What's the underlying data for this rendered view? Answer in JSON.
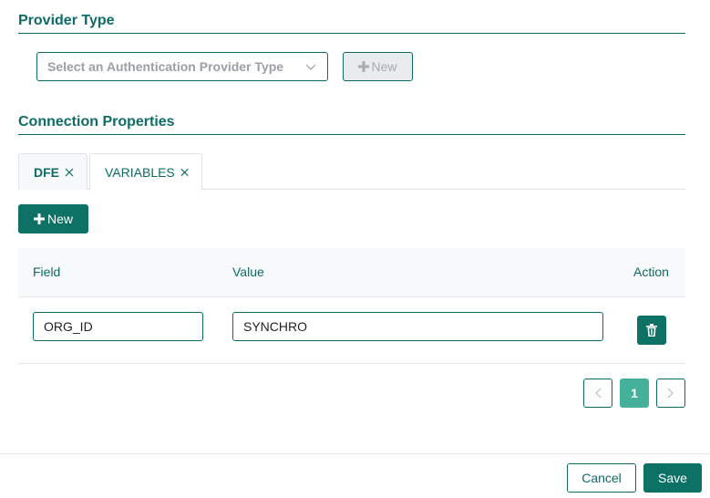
{
  "provider_type": {
    "title": "Provider Type",
    "select_placeholder": "Select an Authentication Provider Type",
    "new_label": "New"
  },
  "connection_properties": {
    "title": "Connection Properties",
    "tabs": [
      {
        "label": "DFE",
        "active": false
      },
      {
        "label": "VARIABLES",
        "active": true
      }
    ],
    "new_label": "New",
    "table": {
      "headers": {
        "field": "Field",
        "value": "Value",
        "action": "Action"
      },
      "rows": [
        {
          "field": "ORG_ID",
          "value": "SYNCHRO"
        }
      ]
    },
    "pagination": {
      "current_page": "1"
    }
  },
  "footer": {
    "cancel_label": "Cancel",
    "save_label": "Save"
  },
  "colors": {
    "primary": "#0e7166",
    "text": "#0e6b66",
    "active_page": "#46b19a"
  }
}
